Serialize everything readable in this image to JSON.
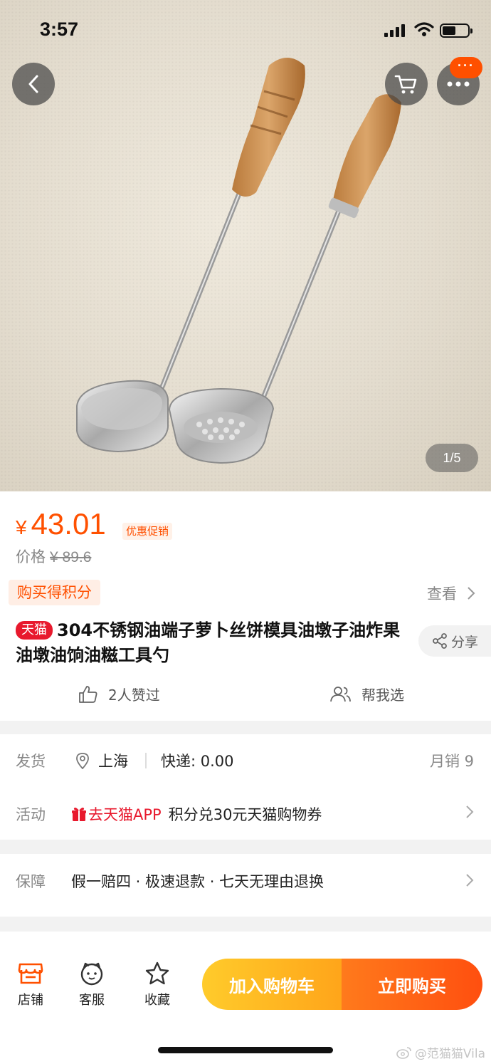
{
  "status_bar": {
    "time": "3:57"
  },
  "hero": {
    "image_alt": "Two stainless-steel ladles with wooden handles",
    "page_indicator": "1/5",
    "message_badge": "···"
  },
  "price": {
    "symbol": "¥",
    "current": "43.01",
    "promo_tag": "优惠促销",
    "original_label": "价格",
    "original_value": "¥ 89.6"
  },
  "points": {
    "tag": "购买得积分",
    "view_label": "查看"
  },
  "product": {
    "platform_tag": "天猫",
    "title": "304不锈钢油端子萝卜丝饼模具油墩子油炸果油墩油饷油糍工具勺",
    "share_label": "分享",
    "likes_label": "2人赞过",
    "help_choose_label": "帮我选"
  },
  "shipping": {
    "label": "发货",
    "origin": "上海",
    "express": "快递: 0.00",
    "monthly_sales": "月销 9"
  },
  "activity": {
    "label": "活动",
    "link": "去天猫APP",
    "text": "积分兑30元天猫购物券"
  },
  "guarantee": {
    "label": "保障",
    "text": "假一赔四 · 极速退款 · 七天无理由退换"
  },
  "bottom_bar": {
    "tabs": [
      {
        "label": "店铺",
        "icon": "store-icon"
      },
      {
        "label": "客服",
        "icon": "customer-service-icon"
      },
      {
        "label": "收藏",
        "icon": "star-icon"
      }
    ],
    "add_to_cart": "加入购物车",
    "buy_now": "立即购买"
  },
  "watermark": "@范猫猫Vila",
  "colors": {
    "accent": "#ff5000",
    "tmall_red": "#e8192d",
    "cart_yellow": "#ffb31f",
    "buy_orange": "#ff5a12"
  }
}
